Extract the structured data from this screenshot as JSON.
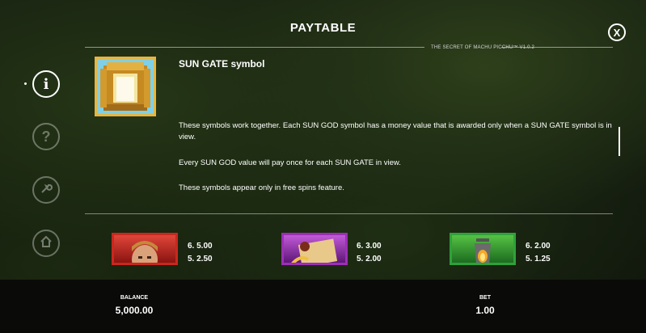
{
  "header": {
    "title": "PAYTABLE",
    "version": "THE SECRET OF MACHU PICCHU™ V1.0.2",
    "close_label": "X"
  },
  "sidebar": {
    "items": [
      {
        "name": "info",
        "icon": "info-icon",
        "glyph": "i",
        "active": true
      },
      {
        "name": "help",
        "icon": "question-icon",
        "glyph": "?",
        "active": false
      },
      {
        "name": "settings",
        "icon": "wrench-icon",
        "glyph": "⚒",
        "active": false
      },
      {
        "name": "home",
        "icon": "home-icon",
        "glyph": "⌂",
        "active": false
      }
    ]
  },
  "feature": {
    "symbol_name": "SUN GATE symbol",
    "paragraphs": [
      "These symbols work together. Each SUN GOD symbol has a money value that is awarded only when a SUN GATE symbol is in view.",
      "Every SUN GOD value will pay once for each SUN GATE in view.",
      "These symbols appear only in free spins feature."
    ]
  },
  "symbols": [
    {
      "name": "explorer",
      "pays": [
        "6. 5.00",
        "5. 2.50"
      ],
      "frame_color": "#c8281e"
    },
    {
      "name": "scroll",
      "pays": [
        "6. 3.00",
        "5. 2.00"
      ],
      "frame_color": "#9c2fb5"
    },
    {
      "name": "lantern",
      "pays": [
        "6. 2.00",
        "5. 1.25"
      ],
      "frame_color": "#2fa13a"
    }
  ],
  "footer": {
    "balance_label": "BALANCE",
    "balance_value": "5,000.00",
    "bet_label": "BET",
    "bet_value": "1.00"
  }
}
